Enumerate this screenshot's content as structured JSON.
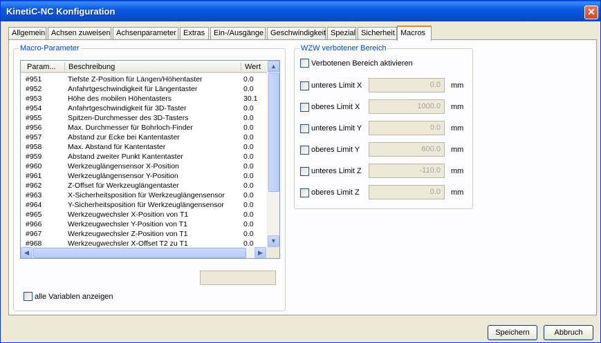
{
  "window": {
    "title": "KinetiC-NC Konfiguration",
    "close_glyph": "✕"
  },
  "tabs": [
    {
      "label": "Allgemein"
    },
    {
      "label": "Achsen zuweisen"
    },
    {
      "label": "Achsenparameter"
    },
    {
      "label": "Extras"
    },
    {
      "label": "Ein-/Ausgänge"
    },
    {
      "label": "Geschwindigkeit"
    },
    {
      "label": "Spezial"
    },
    {
      "label": "Sicherheit"
    },
    {
      "label": "Macros"
    }
  ],
  "macro_group": {
    "title": "Macro-Parameter",
    "columns": {
      "param": "Param...",
      "desc": "Beschreibung",
      "value": "Wert"
    },
    "rows": [
      {
        "param": "#951",
        "desc": "Tiefste Z-Position für Längen/Höhentaster",
        "value": "0.0"
      },
      {
        "param": "#952",
        "desc": "Anfahrtgeschwindigkeit für Längentaster",
        "value": "0.0"
      },
      {
        "param": "#953",
        "desc": "Höhe des mobilen Höhentasters",
        "value": "30.1"
      },
      {
        "param": "#954",
        "desc": "Anfahrtgeschwindigkeit für 3D-Taster",
        "value": "0.0"
      },
      {
        "param": "#955",
        "desc": "Spitzen-Durchmesser des 3D-Tasters",
        "value": "0.0"
      },
      {
        "param": "#956",
        "desc": "Max. Durchmesser für Bohrloch-Finder",
        "value": "0.0"
      },
      {
        "param": "#957",
        "desc": "Abstand zur Ecke bei Kantentaster",
        "value": "0.0"
      },
      {
        "param": "#958",
        "desc": "Max. Abstand für Kantentaster",
        "value": "0.0"
      },
      {
        "param": "#959",
        "desc": "Abstand zweiter Punkt Kantentaster",
        "value": "0.0"
      },
      {
        "param": "#960",
        "desc": "Werkzeuglängensensor X-Position",
        "value": "0.0"
      },
      {
        "param": "#961",
        "desc": "Werkzeuglängensensor Y-Position",
        "value": "0.0"
      },
      {
        "param": "#962",
        "desc": "Z-Offset für Werkzeuglängentaster",
        "value": "0.0"
      },
      {
        "param": "#963",
        "desc": "X-Sicherheitsposition für Werkzeuglängensensor",
        "value": "0.0"
      },
      {
        "param": "#964",
        "desc": "Y-Sicherheitsposition für Werkzeuglängensensor",
        "value": "0.0"
      },
      {
        "param": "#965",
        "desc": "Werkzeugwechsler X-Position von T1",
        "value": "0.0"
      },
      {
        "param": "#966",
        "desc": "Werkzeugwechsler Y-Position von T1",
        "value": "0.0"
      },
      {
        "param": "#967",
        "desc": "Werkzeugwechsler Z-Position von T1",
        "value": "0.0"
      },
      {
        "param": "#968",
        "desc": "Werkzeugwechsler X-Offset T2 zu T1",
        "value": "0.0"
      }
    ],
    "edit_value": "",
    "show_all_label": "alle Variablen anzeigen"
  },
  "wzw_group": {
    "title": "WZW verbotener Bereich",
    "activate_label": "Verbotenen Bereich aktivieren",
    "limits": [
      {
        "label": "unteres Limit X",
        "value": "0.0",
        "unit": "mm"
      },
      {
        "label": "oberes Limit X",
        "value": "1000.0",
        "unit": "mm"
      },
      {
        "label": "unteres Limit Y",
        "value": "0.0",
        "unit": "mm"
      },
      {
        "label": "oberes Limit Y",
        "value": "600.0",
        "unit": "mm"
      },
      {
        "label": "unteres Limit Z",
        "value": "-110.0",
        "unit": "mm"
      },
      {
        "label": "oberes Limit Z",
        "value": "0.0",
        "unit": "mm"
      }
    ]
  },
  "buttons": {
    "save": "Speichern",
    "cancel": "Abbruch"
  },
  "scroll_glyphs": {
    "up": "▲",
    "down": "▼",
    "left": "◀",
    "right": "▶"
  }
}
